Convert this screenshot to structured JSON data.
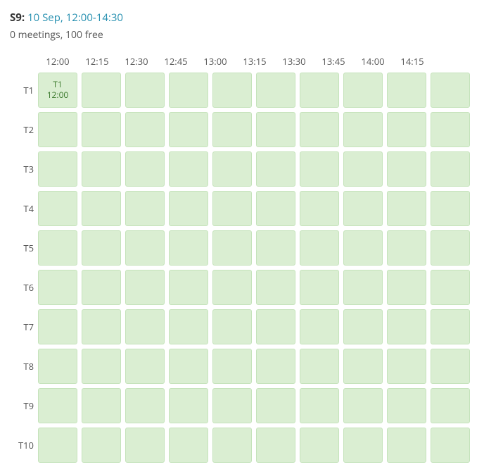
{
  "header": {
    "title_prefix": "S9",
    "date_label": "10 Sep, 12:00-14:30"
  },
  "status": {
    "text": "0 meetings, 100 free"
  },
  "columns": [
    "12:00",
    "12:15",
    "12:30",
    "12:45",
    "13:00",
    "13:15",
    "13:30",
    "13:45",
    "14:00",
    "14:15"
  ],
  "rows": [
    "T1",
    "T2",
    "T3",
    "T4",
    "T5",
    "T6",
    "T7",
    "T8",
    "T9",
    "T10"
  ],
  "first_cell": {
    "line1": "T1",
    "line2": "12:00"
  }
}
